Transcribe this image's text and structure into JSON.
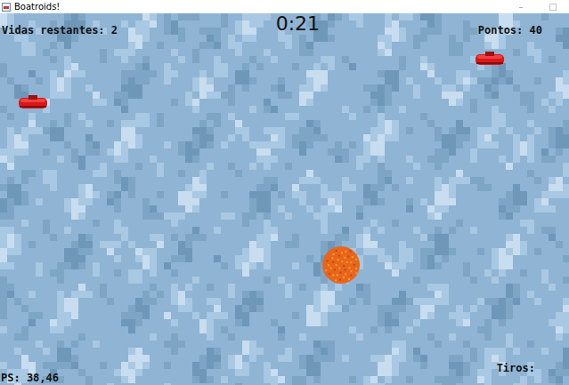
{
  "window": {
    "title": "Boatroids!",
    "controls": [
      "–",
      "□"
    ]
  },
  "hud": {
    "lives": "Vidas restantes: 2",
    "timer": "0:21",
    "score": "Pontos: 40",
    "fps": "PS: 38,46",
    "shots": "Tiros:"
  },
  "entities": [
    {
      "kind": "boat"
    },
    {
      "kind": "boat"
    },
    {
      "kind": "explosion"
    }
  ]
}
